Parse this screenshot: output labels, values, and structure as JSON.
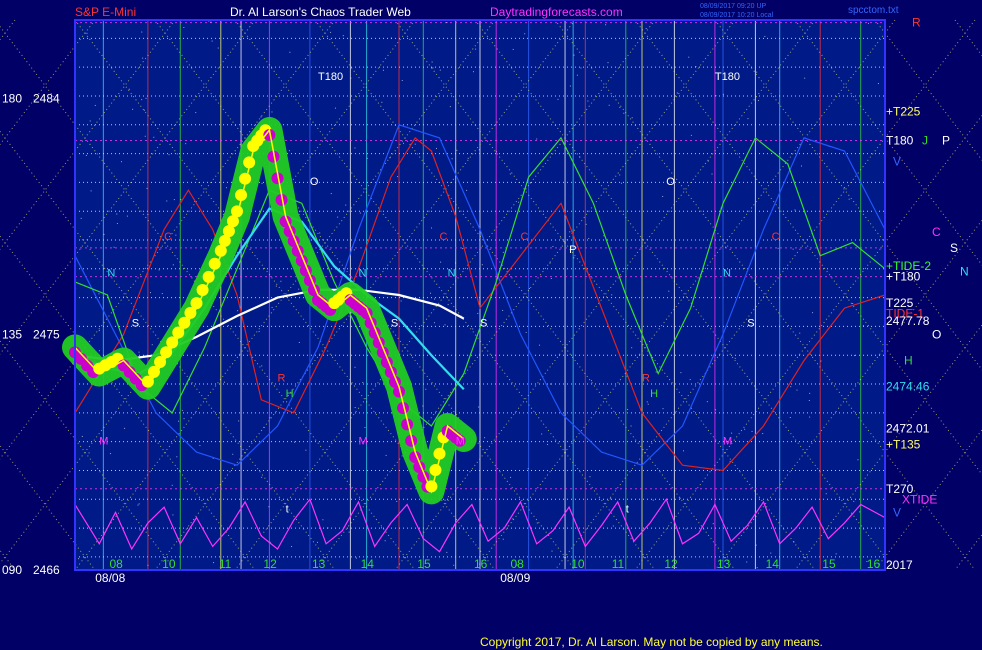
{
  "header": {
    "symbol": "S&P E-Mini",
    "site": "Dr. Al Larson's Chaos Trader Web",
    "url": "Daytradingforecasts.com",
    "stamp1": "08/09/2017 09:20 UP",
    "stamp2": "08/09/2017 10:20 Local",
    "file": "spcctom.txt"
  },
  "footer": {
    "copyright": "Copyright 2017, Dr. Al Larson. May not be copied by any means."
  },
  "colors": {
    "bg": "#000066",
    "plot_bg": "#001a88",
    "grid_yellow": "#ffff66",
    "price_yellow": "#ffff00",
    "price_magenta": "#cc00cc",
    "price_green": "#22cc22",
    "ma_cyan": "#33ddee",
    "ma_white": "#ffffff",
    "line_red": "#dd2222",
    "line_green": "#33dd33",
    "text_red": "#ff3333",
    "text_magenta": "#ff33ff"
  },
  "chart_data": {
    "type": "line",
    "title": "S&P E-Mini",
    "ylim": [
      2466,
      2487
    ],
    "y_labels": [
      {
        "angle": "180",
        "price": "2484",
        "value": 2484
      },
      {
        "angle": "135",
        "price": "2475",
        "value": 2475
      },
      {
        "angle": "090",
        "price": "2466",
        "value": 2466
      }
    ],
    "x_hours": [
      "08",
      "10",
      "11",
      "12",
      "13",
      "14",
      "15",
      "16",
      "08",
      "10",
      "11",
      "12",
      "13",
      "14",
      "15",
      "16"
    ],
    "x_dates": [
      "08/08",
      "08/09"
    ],
    "right_labels": [
      {
        "text": "R",
        "color": "#ff3333",
        "value": 2486.9
      },
      {
        "text": "+T225",
        "color": "#ffff66",
        "value": 2483.5
      },
      {
        "text": "T180",
        "color": "#ffffff",
        "value": 2482.4
      },
      {
        "text": "J",
        "color": "#33dd33",
        "value": 2482.4
      },
      {
        "text": "P",
        "color": "#ffffff",
        "value": 2482.4
      },
      {
        "text": "V",
        "color": "#3366ff",
        "value": 2481.6
      },
      {
        "text": "C",
        "color": "#ff33ff",
        "value": 2478.9
      },
      {
        "text": "S",
        "color": "#ffffff",
        "value": 2478.3
      },
      {
        "text": "+TIDE-2",
        "color": "#33ff33",
        "value": 2477.6
      },
      {
        "text": "N",
        "color": "#33ddee",
        "value": 2477.4
      },
      {
        "text": "+T180",
        "color": "#ffffff",
        "value": 2477.2
      },
      {
        "text": "T225",
        "color": "#ffffff",
        "value": 2476.2
      },
      {
        "text": "TIDE-1",
        "color": "#ff3333",
        "value": 2475.8
      },
      {
        "text": "2477.78",
        "color": "#ffffff",
        "value": 2475.5
      },
      {
        "text": "O",
        "color": "#ffffff",
        "value": 2475.0
      },
      {
        "text": "H",
        "color": "#33dd33",
        "value": 2474.0
      },
      {
        "text": "2474.46",
        "color": "#33ddee",
        "value": 2473.0
      },
      {
        "text": "2472.01",
        "color": "#ffffff",
        "value": 2471.4
      },
      {
        "text": "+T135",
        "color": "#ffff66",
        "value": 2470.8
      },
      {
        "text": "T270",
        "color": "#ffffff",
        "value": 2469.1
      },
      {
        "text": "XTIDE",
        "color": "#ff33ff",
        "value": 2468.7
      },
      {
        "text": "V",
        "color": "#3366ff",
        "value": 2468.2
      },
      {
        "text": "2017",
        "color": "#ffffff",
        "value": 2466.2
      }
    ],
    "letters": [
      {
        "t": "T180",
        "c": "#ffffff",
        "x": 0.3,
        "y": 2484.7
      },
      {
        "t": "T180",
        "c": "#ffffff",
        "x": 0.79,
        "y": 2484.7
      },
      {
        "t": "O",
        "c": "#ffffff",
        "x": 0.29,
        "y": 2480.7
      },
      {
        "t": "O",
        "c": "#ffffff",
        "x": 0.73,
        "y": 2480.7
      },
      {
        "t": "N",
        "c": "#33ddee",
        "x": 0.04,
        "y": 2477.2
      },
      {
        "t": "N",
        "c": "#33ddee",
        "x": 0.35,
        "y": 2477.2
      },
      {
        "t": "N",
        "c": "#33ddee",
        "x": 0.46,
        "y": 2477.2
      },
      {
        "t": "N",
        "c": "#33ddee",
        "x": 0.8,
        "y": 2477.2
      },
      {
        "t": "S",
        "c": "#ffffff",
        "x": 0.07,
        "y": 2475.3
      },
      {
        "t": "S",
        "c": "#ffffff",
        "x": 0.39,
        "y": 2475.3
      },
      {
        "t": "S",
        "c": "#ffffff",
        "x": 0.5,
        "y": 2475.3
      },
      {
        "t": "S",
        "c": "#ffffff",
        "x": 0.83,
        "y": 2475.3
      },
      {
        "t": "C",
        "c": "#ff3333",
        "x": 0.11,
        "y": 2478.6
      },
      {
        "t": "C",
        "c": "#ff3333",
        "x": 0.45,
        "y": 2478.6
      },
      {
        "t": "C",
        "c": "#ff3333",
        "x": 0.55,
        "y": 2478.6
      },
      {
        "t": "C",
        "c": "#ff3333",
        "x": 0.86,
        "y": 2478.6
      },
      {
        "t": "P",
        "c": "#ffffff",
        "x": 0.61,
        "y": 2478.1
      },
      {
        "t": "R",
        "c": "#ff3333",
        "x": 0.25,
        "y": 2473.2
      },
      {
        "t": "R",
        "c": "#ff3333",
        "x": 0.7,
        "y": 2473.2
      },
      {
        "t": "H",
        "c": "#33dd33",
        "x": 0.26,
        "y": 2472.6
      },
      {
        "t": "H",
        "c": "#33dd33",
        "x": 0.71,
        "y": 2472.6
      },
      {
        "t": "M",
        "c": "#ff33ff",
        "x": 0.03,
        "y": 2470.8
      },
      {
        "t": "M",
        "c": "#ff33ff",
        "x": 0.35,
        "y": 2470.8
      },
      {
        "t": "M",
        "c": "#ff33ff",
        "x": 0.47,
        "y": 2470.8
      },
      {
        "t": "M",
        "c": "#ff33ff",
        "x": 0.8,
        "y": 2470.8
      },
      {
        "t": "t",
        "c": "#ffffff",
        "x": 0.26,
        "y": 2468.2
      },
      {
        "t": "t",
        "c": "#ffffff",
        "x": 0.68,
        "y": 2468.2
      }
    ],
    "series": [
      {
        "name": "price",
        "color": "#ffff00",
        "x": [
          0.0,
          0.03,
          0.06,
          0.09,
          0.12,
          0.15,
          0.18,
          0.2,
          0.22,
          0.24,
          0.26,
          0.28,
          0.3,
          0.32,
          0.34,
          0.36,
          0.38,
          0.4,
          0.42,
          0.44,
          0.46,
          0.48
        ],
        "y": [
          2474.5,
          2473.5,
          2474.0,
          2473.0,
          2474.5,
          2476.0,
          2478.0,
          2479.5,
          2482.0,
          2482.8,
          2479.5,
          2478.0,
          2476.5,
          2476.0,
          2476.5,
          2476.0,
          2474.5,
          2473.0,
          2470.5,
          2469.0,
          2471.5,
          2471.0
        ]
      },
      {
        "name": "cyan_ma",
        "color": "#33ddee",
        "x": [
          0.0,
          0.04,
          0.08,
          0.12,
          0.16,
          0.2,
          0.24,
          0.28,
          0.32,
          0.36,
          0.4,
          0.44,
          0.48
        ],
        "y": [
          2474.2,
          2473.7,
          2473.5,
          2474.3,
          2476.0,
          2478.0,
          2479.8,
          2479.3,
          2477.6,
          2476.5,
          2475.6,
          2474.2,
          2472.9
        ]
      },
      {
        "name": "white_ma",
        "color": "#ffffff",
        "x": [
          0.0,
          0.05,
          0.1,
          0.15,
          0.2,
          0.25,
          0.3,
          0.35,
          0.4,
          0.45,
          0.48
        ],
        "y": [
          2474.2,
          2474.0,
          2474.2,
          2474.9,
          2475.7,
          2476.4,
          2476.7,
          2476.7,
          2476.5,
          2476.1,
          2475.6
        ]
      },
      {
        "name": "red_line",
        "color": "#dd2222",
        "x": [
          0.0,
          0.06,
          0.11,
          0.14,
          0.17,
          0.2,
          0.23,
          0.27,
          0.31,
          0.35,
          0.39,
          0.42,
          0.44,
          0.47,
          0.5,
          0.55,
          0.6,
          0.65,
          0.7,
          0.75,
          0.8,
          0.85,
          0.9,
          0.95,
          1.0
        ],
        "y": [
          2472.0,
          2475.0,
          2479.0,
          2480.5,
          2479.0,
          2476.5,
          2472.5,
          2472.0,
          2474.5,
          2477.5,
          2481.0,
          2482.5,
          2482.0,
          2479.5,
          2476.0,
          2478.0,
          2480.0,
          2476.0,
          2472.0,
          2470.0,
          2469.8,
          2471.5,
          2474.0,
          2476.0,
          2476.5
        ]
      },
      {
        "name": "green_line",
        "color": "#33dd33",
        "x": [
          0.0,
          0.04,
          0.08,
          0.12,
          0.16,
          0.2,
          0.24,
          0.28,
          0.32,
          0.36,
          0.4,
          0.44,
          0.48,
          0.52,
          0.56,
          0.6,
          0.64,
          0.68,
          0.72,
          0.76,
          0.8,
          0.84,
          0.88,
          0.92,
          0.96,
          1.0
        ],
        "y": [
          2477.0,
          2476.5,
          2473.0,
          2472.0,
          2474.5,
          2477.5,
          2480.5,
          2480.0,
          2477.0,
          2474.5,
          2472.5,
          2471.5,
          2473.5,
          2477.0,
          2481.0,
          2482.5,
          2480.0,
          2476.5,
          2473.5,
          2476.0,
          2480.0,
          2482.5,
          2481.5,
          2478.0,
          2478.5,
          2477.5
        ]
      },
      {
        "name": "blue_line",
        "color": "#2255ff",
        "x": [
          0.0,
          0.05,
          0.1,
          0.15,
          0.2,
          0.25,
          0.3,
          0.35,
          0.4,
          0.45,
          0.5,
          0.55,
          0.6,
          0.65,
          0.7,
          0.75,
          0.8,
          0.85,
          0.9,
          0.95,
          1.0
        ],
        "y": [
          2478.0,
          2475.0,
          2472.0,
          2470.5,
          2470.0,
          2471.5,
          2474.5,
          2479.0,
          2483.0,
          2482.5,
          2479.0,
          2475.0,
          2472.0,
          2470.5,
          2470.0,
          2471.5,
          2475.0,
          2479.0,
          2482.5,
          2482.0,
          2479.0
        ]
      },
      {
        "name": "magenta_oscillator",
        "color": "#ff33ff",
        "x": [
          0.0,
          0.03,
          0.05,
          0.07,
          0.09,
          0.11,
          0.13,
          0.15,
          0.17,
          0.19,
          0.21,
          0.23,
          0.25,
          0.27,
          0.29,
          0.31,
          0.33,
          0.35,
          0.37,
          0.39,
          0.41,
          0.43,
          0.45,
          0.47,
          0.49,
          0.51,
          0.53,
          0.55,
          0.57,
          0.59,
          0.61,
          0.63,
          0.65,
          0.67,
          0.69,
          0.71,
          0.73,
          0.75,
          0.77,
          0.79,
          0.81,
          0.83,
          0.85,
          0.87,
          0.89,
          0.91,
          0.93,
          0.95,
          0.97,
          1.0
        ],
        "y": [
          2468.5,
          2467.0,
          2468.2,
          2466.8,
          2467.8,
          2468.4,
          2467.0,
          2468.0,
          2466.9,
          2467.6,
          2468.6,
          2467.3,
          2466.8,
          2467.9,
          2468.7,
          2467.0,
          2467.5,
          2468.6,
          2466.9,
          2467.8,
          2468.5,
          2467.2,
          2466.7,
          2467.8,
          2468.5,
          2467.1,
          2467.6,
          2468.6,
          2467.0,
          2467.5,
          2468.4,
          2466.9,
          2467.7,
          2468.6,
          2467.1,
          2467.8,
          2468.7,
          2467.0,
          2467.4,
          2468.5,
          2467.1,
          2467.7,
          2468.6,
          2467.0,
          2467.6,
          2468.4,
          2467.2,
          2467.8,
          2468.5,
          2468.0
        ]
      }
    ]
  }
}
